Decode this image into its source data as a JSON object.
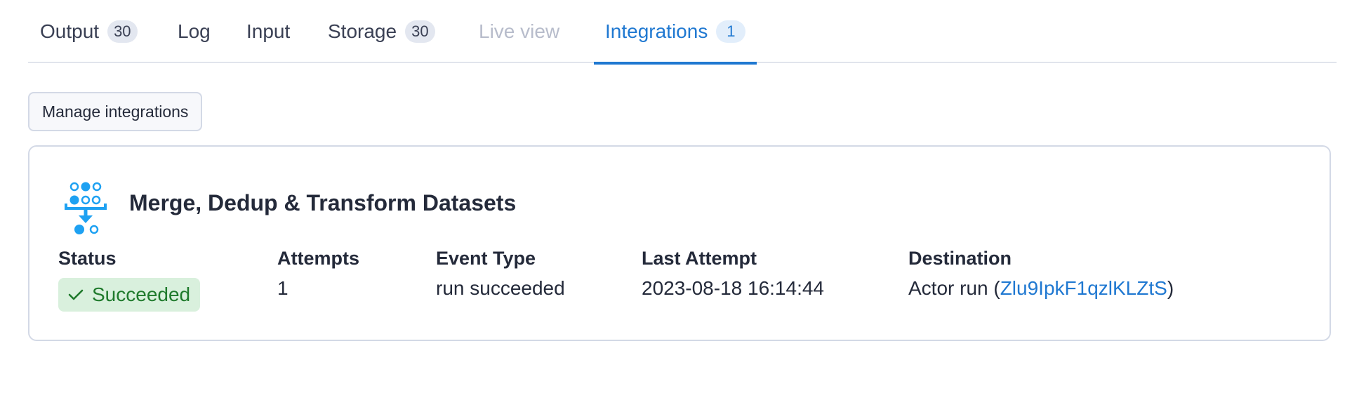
{
  "tabs": [
    {
      "label": "Output",
      "badge": "30",
      "state": "normal"
    },
    {
      "label": "Log",
      "badge": null,
      "state": "normal"
    },
    {
      "label": "Input",
      "badge": null,
      "state": "normal"
    },
    {
      "label": "Storage",
      "badge": "30",
      "state": "normal"
    },
    {
      "label": "Live view",
      "badge": null,
      "state": "disabled"
    },
    {
      "label": "Integrations",
      "badge": "1",
      "state": "active"
    }
  ],
  "manage_button": {
    "label": "Manage integrations"
  },
  "integration": {
    "title": "Merge, Dedup & Transform Datasets",
    "icon": "merge-dataset-icon",
    "columns": {
      "status": {
        "header": "Status",
        "value": "Succeeded",
        "icon": "check-icon"
      },
      "attempts": {
        "header": "Attempts",
        "value": "1"
      },
      "event_type": {
        "header": "Event Type",
        "value": "run succeeded"
      },
      "last_attempt": {
        "header": "Last Attempt",
        "value": "2023-08-18 16:14:44"
      },
      "destination": {
        "header": "Destination",
        "prefix": "Actor run (",
        "link": "Zlu9IpkF1qzlKLZtS",
        "suffix": ")"
      }
    }
  },
  "colors": {
    "accent": "#1f78d1",
    "success_bg": "#d9f0dd",
    "success_text": "#1f7a2c",
    "icon_blue": "#1ea1f2"
  }
}
